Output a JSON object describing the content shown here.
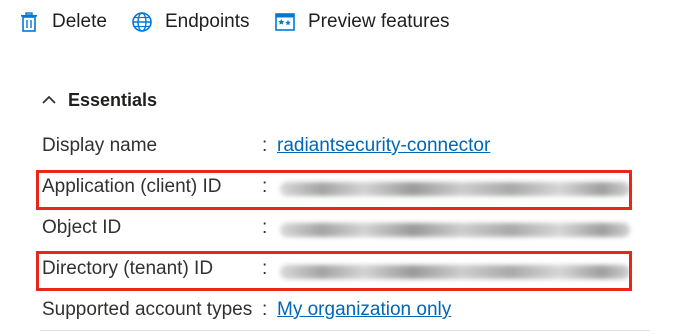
{
  "toolbar": {
    "delete_label": "Delete",
    "endpoints_label": "Endpoints",
    "preview_label": "Preview features"
  },
  "essentials": {
    "title": "Essentials",
    "rows": [
      {
        "key": "Display name",
        "colon": ":",
        "value": "radiantsecurity-connector"
      },
      {
        "key": "Application (client) ID",
        "colon": ":",
        "value": ""
      },
      {
        "key": "Object ID",
        "colon": ":",
        "value": ""
      },
      {
        "key": "Directory (tenant) ID",
        "colon": ":",
        "value": ""
      },
      {
        "key": "Supported account types",
        "colon": ":",
        "value": "My organization only"
      }
    ]
  },
  "colors": {
    "link": "#0067b8",
    "highlight": "#e8271b",
    "accent": "#0078d4"
  },
  "icons": [
    "trash-icon",
    "globe-icon",
    "preview-features-icon",
    "chevron-up-icon"
  ]
}
